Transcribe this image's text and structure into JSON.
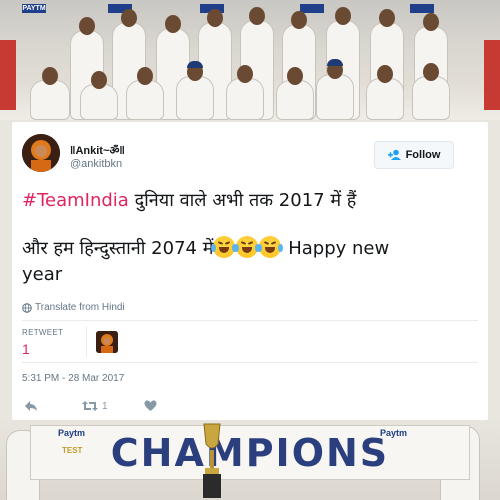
{
  "background": {
    "sponsor_top": "PAYTM",
    "board_text": "CHAMPIONS",
    "board_brand_left": "Paytm",
    "board_brand_right": "Paytm",
    "board_sub_left": "TEST"
  },
  "tweet": {
    "display_name": "‖Ankit~ॐ‖",
    "handle": "@ankitbkn",
    "follow_label": "Follow",
    "text": {
      "hashtag": "#TeamIndia",
      "line1_rest": " दुनिया वाले अभी तक 2017 में हैं",
      "line2": "और हम हिन्दुस्तानी 2074 में",
      "line2_tail": " Happy new",
      "line3": "year"
    },
    "translate_label": "Translate from Hindi",
    "retweet_label": "RETWEET",
    "retweet_count": "1",
    "timestamp": "5:31 PM - 28 Mar 2017",
    "actions": {
      "retweet_count": "1"
    }
  },
  "colors": {
    "accent_pink": "#e0245e",
    "text_gray": "#657786",
    "text_dark": "#14171a"
  },
  "icons": [
    "follow-user-icon",
    "globe-icon",
    "reply-icon",
    "retweet-icon",
    "like-heart-icon",
    "crying-laughing-emoji"
  ]
}
